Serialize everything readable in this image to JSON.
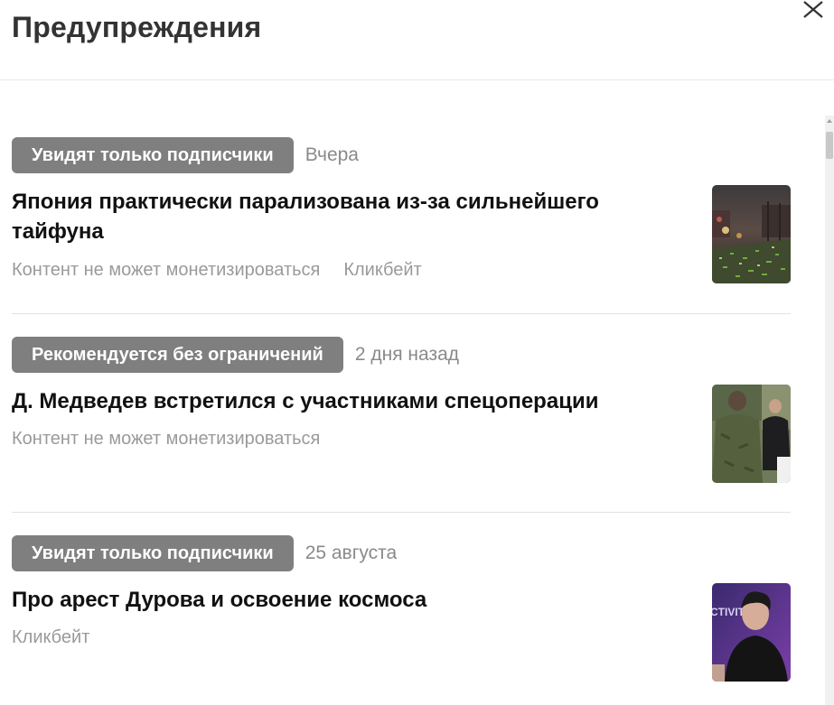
{
  "header": {
    "title": "Предупреждения",
    "close_icon": "close-icon"
  },
  "items": [
    {
      "badge": "Увидят только подписчики",
      "date": "Вчера",
      "headline": "Япония практически парализована из-за сильнейшего тайфуна",
      "tags": [
        "Контент не может монетизироваться",
        "Кликбейт"
      ],
      "thumbnail": "typhoon-street-photo"
    },
    {
      "badge": "Рекомендуется без ограничений",
      "date": "2 дня назад",
      "headline": "Д. Медведев встретился с участниками спецоперации",
      "tags": [
        "Контент не может монетизироваться"
      ],
      "thumbnail": "meeting-photo"
    },
    {
      "badge": "Увидят только подписчики",
      "date": "25 августа",
      "headline": "Про арест Дурова и освоение космоса",
      "tags": [
        "Кликбейт"
      ],
      "thumbnail": "portrait-photo",
      "thumbnail_text": "CTIVIT"
    }
  ]
}
